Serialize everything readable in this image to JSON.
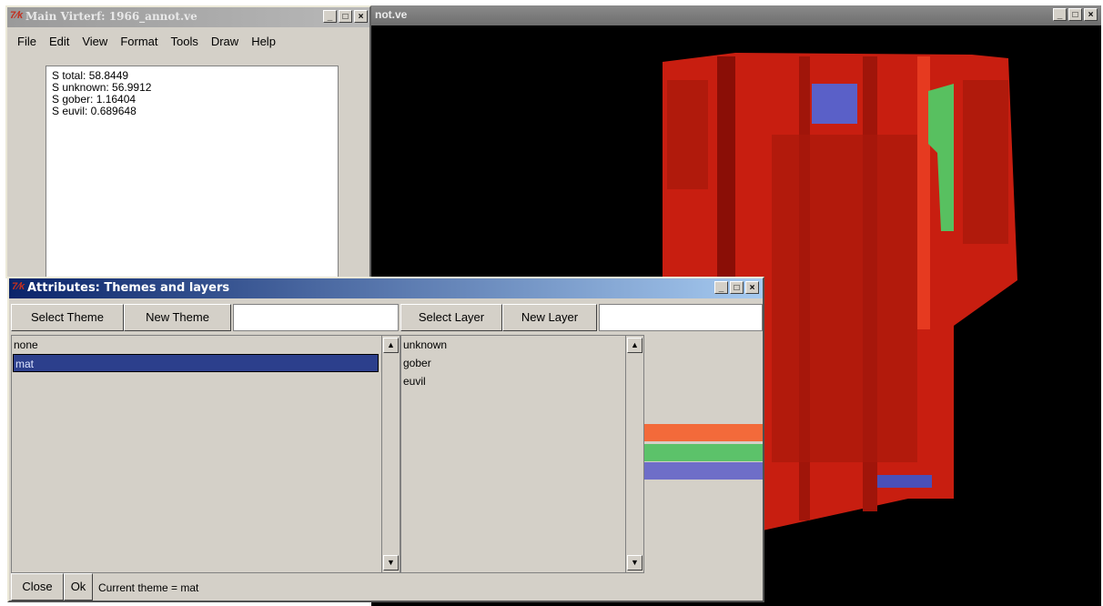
{
  "viewer": {
    "title": "not.ve"
  },
  "main": {
    "title": "Main Virterf: 1966_annot.ve",
    "menu": [
      "File",
      "Edit",
      "View",
      "Format",
      "Tools",
      "Draw",
      "Help"
    ],
    "output_lines": [
      "S total: 58.8449",
      "S unknown: 56.9912",
      "S gober: 1.16404",
      "S euvil: 0.689648"
    ]
  },
  "attributes": {
    "title": "Attributes: Themes and layers",
    "select_theme": "Select Theme",
    "new_theme": "New Theme",
    "theme_entry": "",
    "select_layer": "Select Layer",
    "new_layer": "New Layer",
    "layer_entry": "",
    "themes": [
      "none",
      "mat"
    ],
    "selected_theme": "mat",
    "layers": [
      "unknown",
      "gober",
      "euvil"
    ],
    "layer_colors": [
      "#f36a3a",
      "#5cc26a",
      "#6e6ec8"
    ],
    "close": "Close",
    "ok": "Ok",
    "status": "Current theme = mat"
  },
  "window_buttons": {
    "minimize": "_",
    "maximize": "□",
    "close": "×"
  },
  "tk_logo": "7⁄k"
}
